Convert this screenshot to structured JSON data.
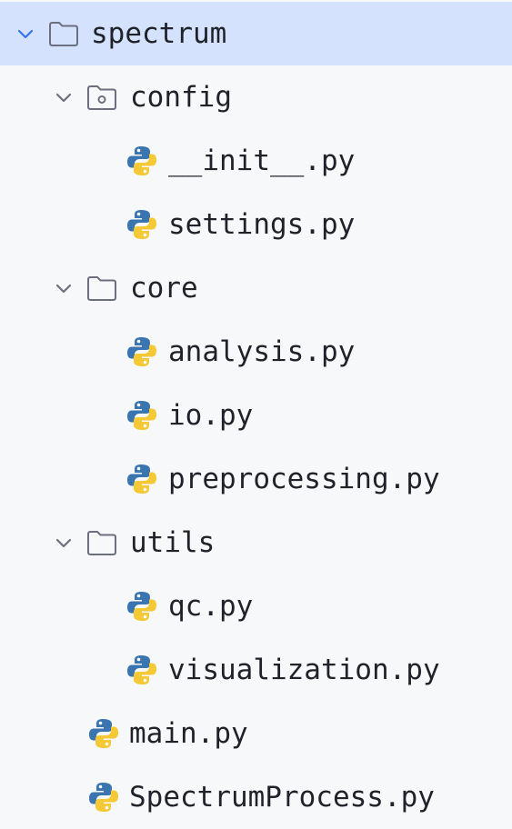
{
  "tree": {
    "root": {
      "label": "spectrum",
      "icon": "folder-icon",
      "expanded": true,
      "selected": true
    },
    "config": {
      "label": "config",
      "icon": "folder-config-icon",
      "expanded": true
    },
    "config_init": {
      "label": "__init__.py",
      "icon": "python-icon"
    },
    "config_settings": {
      "label": "settings.py",
      "icon": "python-icon"
    },
    "core": {
      "label": "core",
      "icon": "folder-icon",
      "expanded": true
    },
    "core_analysis": {
      "label": "analysis.py",
      "icon": "python-icon"
    },
    "core_io": {
      "label": "io.py",
      "icon": "python-icon"
    },
    "core_preprocessing": {
      "label": "preprocessing.py",
      "icon": "python-icon"
    },
    "utils": {
      "label": "utils",
      "icon": "folder-icon",
      "expanded": true
    },
    "utils_qc": {
      "label": "qc.py",
      "icon": "python-icon"
    },
    "utils_visualization": {
      "label": "visualization.py",
      "icon": "python-icon"
    },
    "main": {
      "label": "main.py",
      "icon": "python-icon"
    },
    "spectrum_process": {
      "label": "SpectrumProcess.py",
      "icon": "python-icon"
    }
  },
  "colors": {
    "selection": "#d4e2fd",
    "chevron_selected": "#3574f0",
    "chevron": "#6c707e",
    "folder_stroke": "#6c707e",
    "python_blue": "#3a75b0",
    "python_yellow": "#f5c935",
    "text": "#1f2329"
  }
}
